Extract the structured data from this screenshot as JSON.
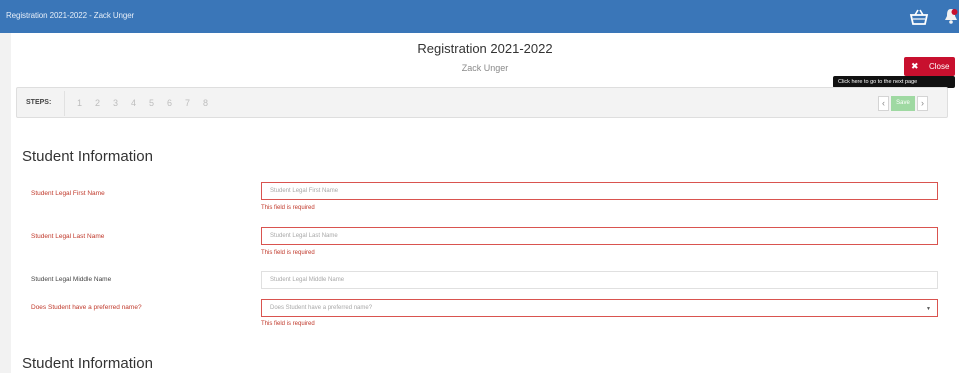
{
  "topbar": {
    "title": "Registration 2021-2022 - Zack Unger",
    "icons": [
      "basket-icon",
      "bell-icon"
    ]
  },
  "header": {
    "title": "Registration 2021-2022",
    "subtitle": "Zack Unger",
    "close_label": "Close",
    "close_icon": "✖",
    "tooltip": "Click here to go to the next page"
  },
  "steps": {
    "label": "STEPS:",
    "items": [
      "1",
      "2",
      "3",
      "4",
      "5",
      "6",
      "7",
      "8"
    ],
    "prev": "‹",
    "save_label": "Save",
    "next": "›"
  },
  "section": {
    "title": "Student Information",
    "next_title": "Student Information"
  },
  "fields": [
    {
      "label": "Student Legal First Name",
      "placeholder": "Student Legal First Name",
      "error": "This field is required",
      "required": true
    },
    {
      "label": "Student Legal Last Name",
      "placeholder": "Student Legal Last Name",
      "error": "This field is required",
      "required": true
    },
    {
      "label": "Student Legal Middle Name",
      "placeholder": "Student Legal Middle Name",
      "error": "",
      "required": false
    },
    {
      "label": "Does Student have a preferred name?",
      "placeholder": "Does Student have a preferred name?",
      "error": "This field is required",
      "required": true,
      "caret": "▼"
    }
  ],
  "colors": {
    "topbar": "#3a76b8",
    "close": "#c8102e",
    "error": "#c0392b",
    "save": "#9fd9a2"
  }
}
